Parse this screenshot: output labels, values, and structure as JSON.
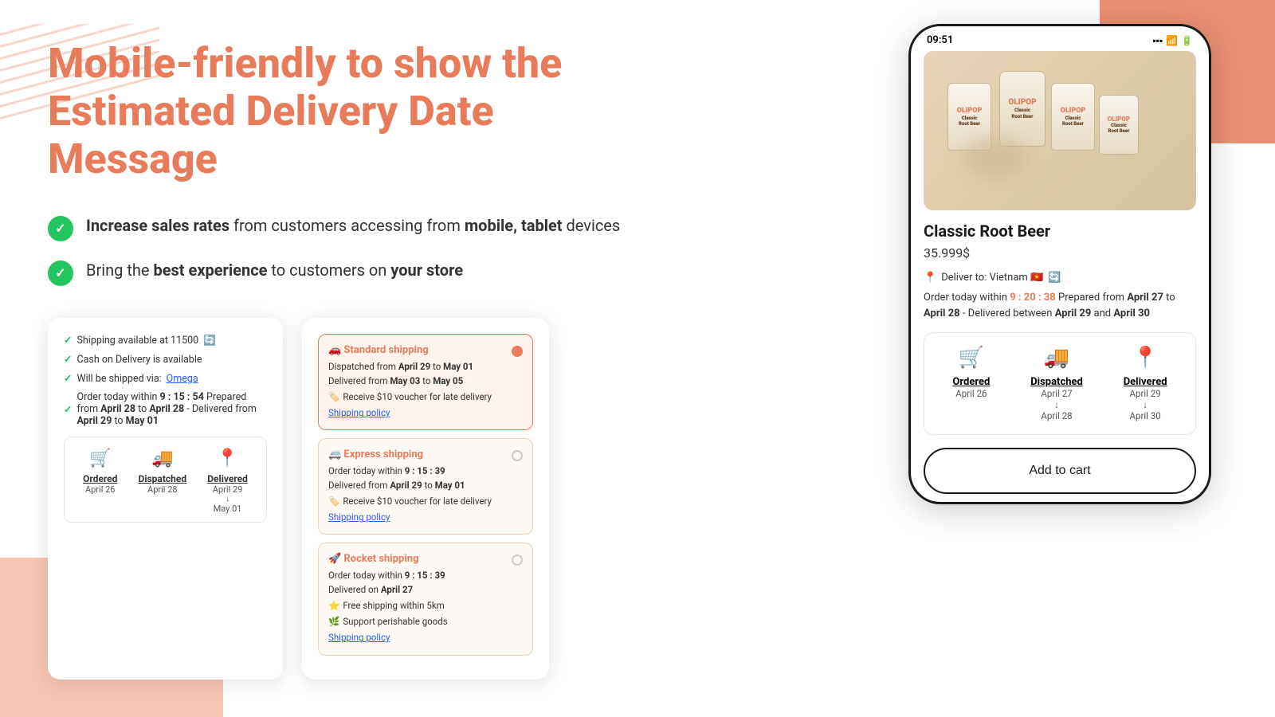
{
  "page": {
    "title": "Mobile-friendly to show the Estimated Delivery Date Message",
    "features": [
      {
        "id": "feature-1",
        "text_prefix": "",
        "bold_part": "Increase sales rates",
        "text_suffix": " from customers accessing from ",
        "bold_part2": "mobile, tablet",
        "text_suffix2": " devices"
      },
      {
        "id": "feature-2",
        "text_prefix": "Bring the ",
        "bold_part": "best experience",
        "text_suffix": " to customers on ",
        "bold_part2": "your store",
        "text_suffix2": ""
      }
    ]
  },
  "card1": {
    "shipping_available": "Shipping available at 11500",
    "cod": "Cash on Delivery is available",
    "shipped_via": "Will be shipped via:",
    "shipped_link": "Omega",
    "order_text": "Order today within",
    "time": "9 : 15 : 54",
    "prepared": "Prepared from",
    "date1": "April 28",
    "to": "to",
    "date2": "April 28",
    "dash": "-",
    "delivered": "Delivered from",
    "date3": "April 29",
    "to2": "to",
    "date4": "May 01",
    "timeline": {
      "steps": [
        {
          "icon": "🛒",
          "label": "Ordered",
          "date": "April 26"
        },
        {
          "icon": "🚚",
          "label": "Dispatched",
          "date": "April 28"
        },
        {
          "icon": "📍",
          "label": "Delivered",
          "date1": "April 29",
          "arrow": "↓",
          "date2": "May 01"
        }
      ]
    }
  },
  "card2": {
    "options": [
      {
        "id": "standard",
        "emoji": "🚗",
        "title": "Standard shipping",
        "dispatched_from": "April 29",
        "dispatched_to": "May 01",
        "delivered_from": "May 03",
        "delivered_to": "May 05",
        "voucher": "Receive $10 voucher for late delivery",
        "policy": "Shipping policy",
        "selected": true
      },
      {
        "id": "express",
        "emoji": "🚐",
        "title": "Express shipping",
        "order_within": "9 : 15 : 39",
        "delivered_from": "April 29",
        "delivered_to": "May 01",
        "voucher": "Receive $10 voucher for late delivery",
        "policy": "Shipping policy",
        "selected": false
      },
      {
        "id": "rocket",
        "emoji": "🚀",
        "title": "Rocket shipping",
        "order_within": "9 : 15 : 39",
        "delivered_on": "April 27",
        "free_shipping": "Free shipping within 5km",
        "perishable": "Support perishable goods",
        "policy": "Shipping policy",
        "selected": false
      }
    ]
  },
  "phone": {
    "status_bar": {
      "time": "09:51",
      "signal": "▪▪▪",
      "wifi": "wifi",
      "battery": "battery"
    },
    "product": {
      "name": "Classic Root Beer",
      "price": "35.999$"
    },
    "delivery": {
      "deliver_to_label": "Deliver to: Vietnam",
      "order_within_label": "Order today within",
      "time": "9 : 20 : 38",
      "prepared_label": "Prepared from",
      "prepared_from": "April 27",
      "prepared_to": "April 28",
      "delivered_between": "April 29",
      "delivered_and": "April 30"
    },
    "timeline": {
      "steps": [
        {
          "icon": "🛒",
          "label": "Ordered",
          "date": "April 26"
        },
        {
          "icon": "🚚",
          "label": "Dispatched",
          "date1": "April 27",
          "arrow": "↓",
          "date2": "April 28"
        },
        {
          "icon": "📍",
          "label": "Delivered",
          "date1": "April 29",
          "arrow": "↓",
          "date2": "April 30"
        }
      ]
    },
    "add_to_cart": "Add to cart"
  }
}
